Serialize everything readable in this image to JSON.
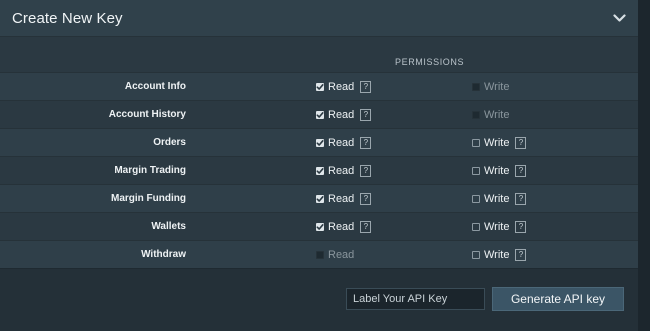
{
  "header": {
    "title": "Create New Key",
    "collapse_icon": "chevron-down-icon"
  },
  "permissions_heading": "PERMISSIONS",
  "rows": [
    {
      "label": "Account Info",
      "read": "Read",
      "read_state": "checked",
      "read_help": "?",
      "write": "Write",
      "write_state": "disabled",
      "write_help": ""
    },
    {
      "label": "Account History",
      "read": "Read",
      "read_state": "checked",
      "read_help": "?",
      "write": "Write",
      "write_state": "disabled",
      "write_help": ""
    },
    {
      "label": "Orders",
      "read": "Read",
      "read_state": "checked",
      "read_help": "?",
      "write": "Write",
      "write_state": "unchecked",
      "write_help": "?"
    },
    {
      "label": "Margin Trading",
      "read": "Read",
      "read_state": "checked",
      "read_help": "?",
      "write": "Write",
      "write_state": "unchecked",
      "write_help": "?"
    },
    {
      "label": "Margin Funding",
      "read": "Read",
      "read_state": "checked",
      "read_help": "?",
      "write": "Write",
      "write_state": "unchecked",
      "write_help": "?"
    },
    {
      "label": "Wallets",
      "read": "Read",
      "read_state": "checked",
      "read_help": "?",
      "write": "Write",
      "write_state": "unchecked",
      "write_help": "?"
    },
    {
      "label": "Withdraw",
      "read": "Read",
      "read_state": "disabled",
      "read_help": "",
      "write": "Write",
      "write_state": "unchecked",
      "write_help": "?"
    }
  ],
  "footer": {
    "input_placeholder": "Label Your API Key",
    "input_value": "",
    "generate_label": "Generate API key"
  },
  "colors": {
    "background": "#2b3942",
    "header": "#30414b",
    "button": "#3b5566"
  }
}
